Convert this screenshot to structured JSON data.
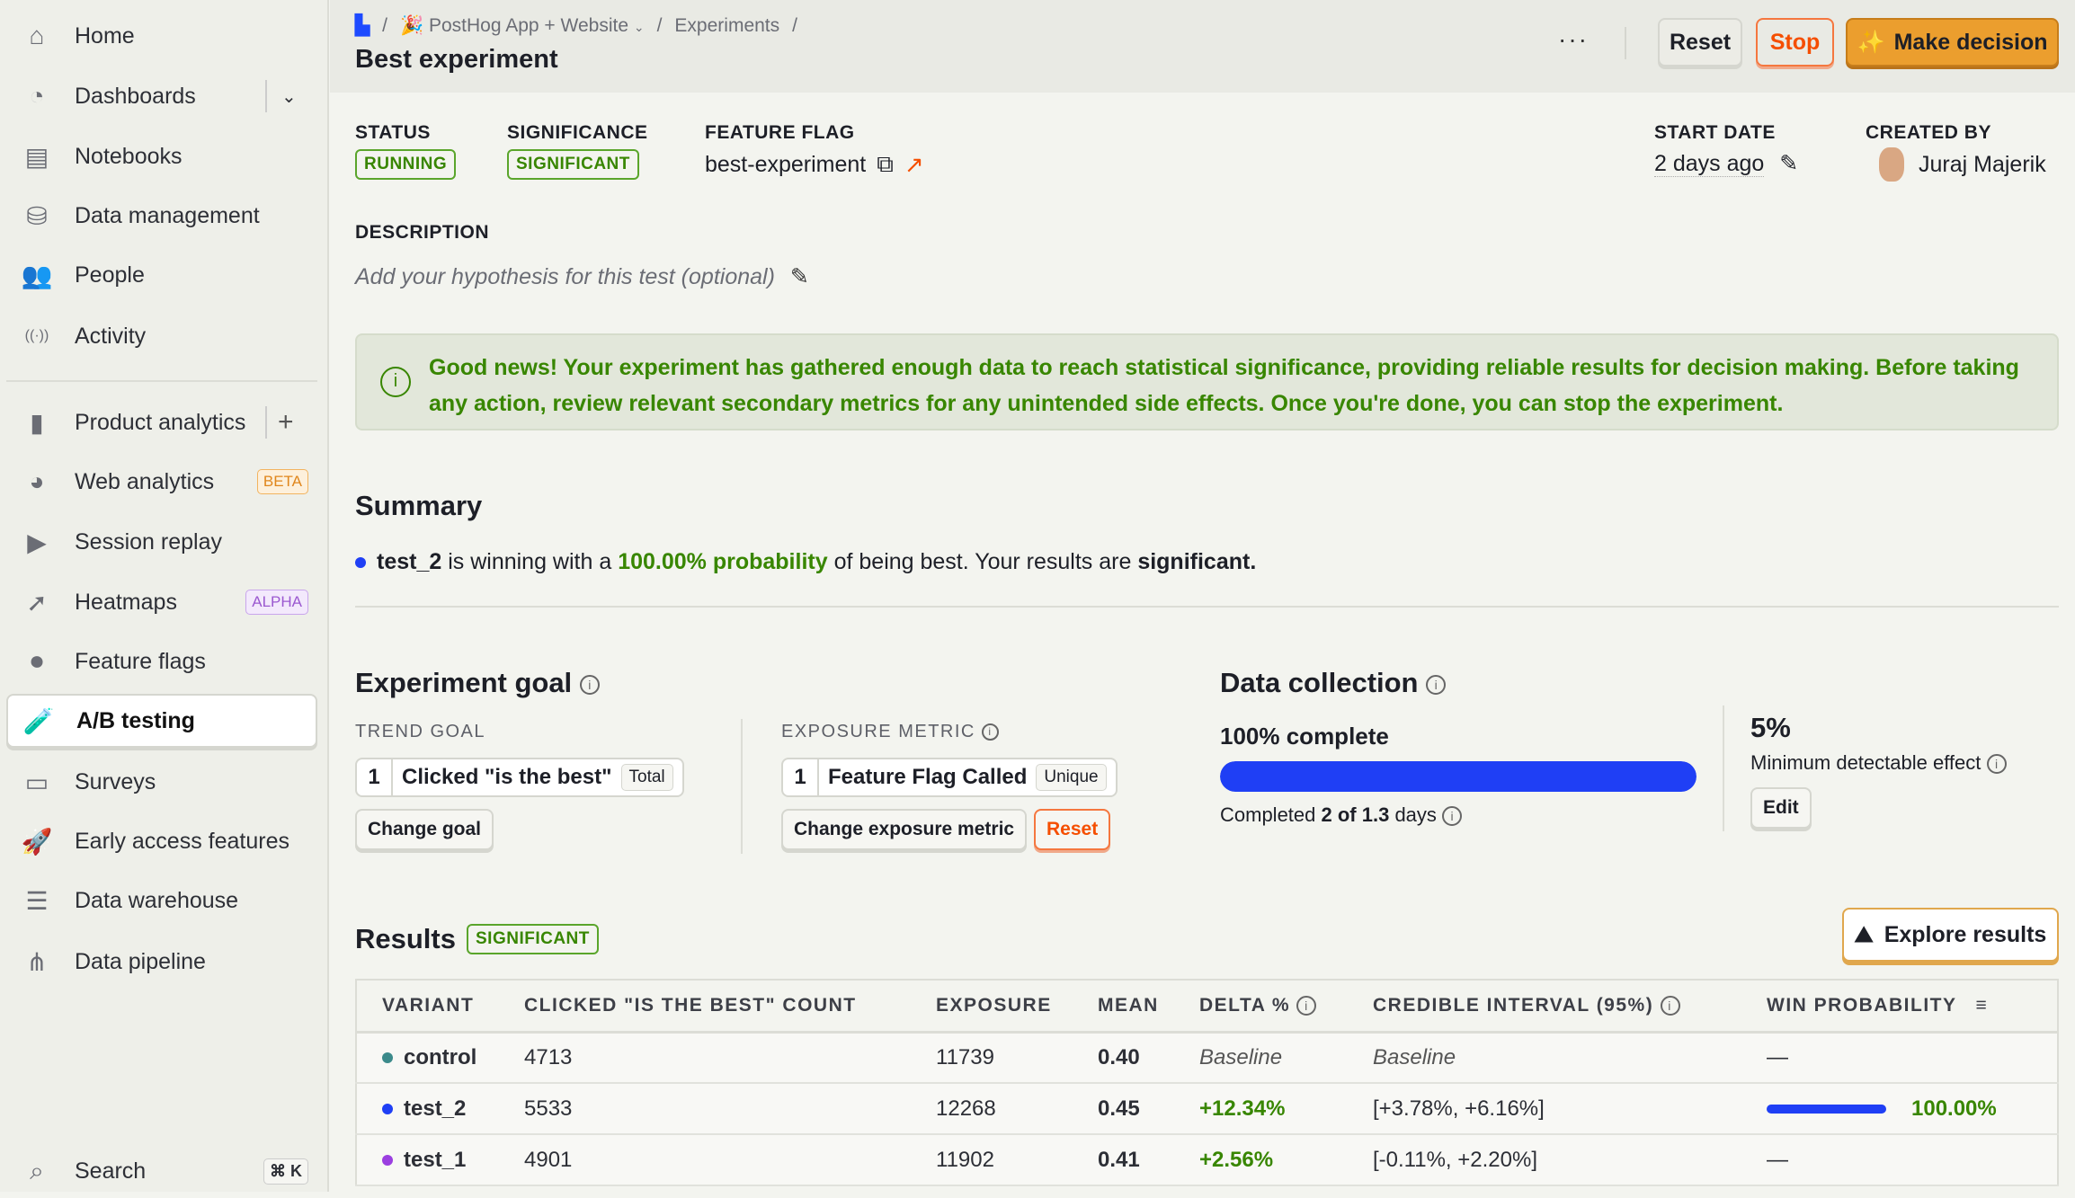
{
  "sidebar": {
    "items": [
      {
        "label": "Home",
        "icon": "home-icon"
      },
      {
        "label": "Dashboards",
        "icon": "dashboard-icon"
      },
      {
        "label": "Notebooks",
        "icon": "notebook-icon"
      },
      {
        "label": "Data management",
        "icon": "database-icon"
      },
      {
        "label": "People",
        "icon": "people-icon"
      },
      {
        "label": "Activity",
        "icon": "activity-icon"
      },
      {
        "label": "Product analytics",
        "icon": "bar-chart-icon"
      },
      {
        "label": "Web analytics",
        "icon": "pie-chart-icon",
        "tag": "BETA"
      },
      {
        "label": "Session replay",
        "icon": "play-icon"
      },
      {
        "label": "Heatmaps",
        "icon": "cursor-click-icon",
        "tag": "ALPHA"
      },
      {
        "label": "Feature flags",
        "icon": "toggle-icon"
      },
      {
        "label": "A/B testing",
        "icon": "flask-icon"
      },
      {
        "label": "Surveys",
        "icon": "survey-icon"
      },
      {
        "label": "Early access features",
        "icon": "rocket-icon"
      },
      {
        "label": "Data warehouse",
        "icon": "warehouse-icon"
      },
      {
        "label": "Data pipeline",
        "icon": "pipeline-icon"
      }
    ],
    "search": {
      "label": "Search",
      "shortcut": "⌘ K"
    }
  },
  "header": {
    "breadcrumb": [
      "PostHog App + Website",
      "Experiments"
    ],
    "title": "Best experiment",
    "reset": "Reset",
    "stop": "Stop",
    "make_decision": "Make decision"
  },
  "meta": {
    "status_label": "STATUS",
    "status": "RUNNING",
    "significance_label": "SIGNIFICANCE",
    "significance": "SIGNIFICANT",
    "flag_label": "FEATURE FLAG",
    "flag": "best-experiment",
    "start_label": "START DATE",
    "start": "2 days ago",
    "created_label": "CREATED BY",
    "created": "Juraj Majerik"
  },
  "description": {
    "label": "DESCRIPTION",
    "placeholder": "Add your hypothesis for this test (optional)"
  },
  "banner": "Good news! Your experiment has gathered enough data to reach statistical significance, providing reliable results for decision making. Before taking any action, review relevant secondary metrics for any unintended side effects. Once you're done, you can stop the experiment.",
  "summary": {
    "title": "Summary",
    "variant": "test_2",
    "t1": " is winning with a ",
    "prob": "100.00% probability",
    "t2": " of being best. Your results are ",
    "sig": "significant."
  },
  "goal": {
    "title": "Experiment goal",
    "trend_label": "TREND GOAL",
    "trend_num": "1",
    "trend_name": "Clicked \"is the best\"",
    "trend_kind": "Total",
    "change_goal": "Change goal",
    "exposure_label": "EXPOSURE METRIC",
    "exp_num": "1",
    "exp_name": "Feature Flag Called",
    "exp_kind": "Unique",
    "change_exposure": "Change exposure metric",
    "reset": "Reset"
  },
  "collection": {
    "title": "Data collection",
    "complete": "100% complete",
    "progress": 100,
    "done_prefix": "Completed ",
    "done_bold": "2 of 1.3",
    "done_suffix": " days",
    "mde": "5%",
    "mde_label": "Minimum detectable effect",
    "edit": "Edit"
  },
  "results": {
    "title": "Results",
    "badge": "SIGNIFICANT",
    "explore": "Explore results",
    "columns": [
      "VARIANT",
      "CLICKED \"IS THE BEST\" COUNT",
      "EXPOSURE",
      "MEAN",
      "DELTA %",
      "CREDIBLE INTERVAL (95%)",
      "WIN PROBABILITY"
    ],
    "rows": [
      {
        "variant": "control",
        "color": "#3b8a8a",
        "count": "4713",
        "exposure": "11739",
        "mean": "0.40",
        "delta": "Baseline",
        "ci": "Baseline",
        "win": "—",
        "win_pct": null
      },
      {
        "variant": "test_2",
        "color": "#1f3ff5",
        "count": "5533",
        "exposure": "12268",
        "mean": "0.45",
        "delta": "+12.34%",
        "ci": "[+3.78%, +6.16%]",
        "win": "100.00%",
        "win_pct": 100
      },
      {
        "variant": "test_1",
        "color": "#9b3fe0",
        "count": "4901",
        "exposure": "11902",
        "mean": "0.41",
        "delta": "+2.56%",
        "ci": "[-0.11%, +2.20%]",
        "win": "—",
        "win_pct": null
      }
    ]
  }
}
